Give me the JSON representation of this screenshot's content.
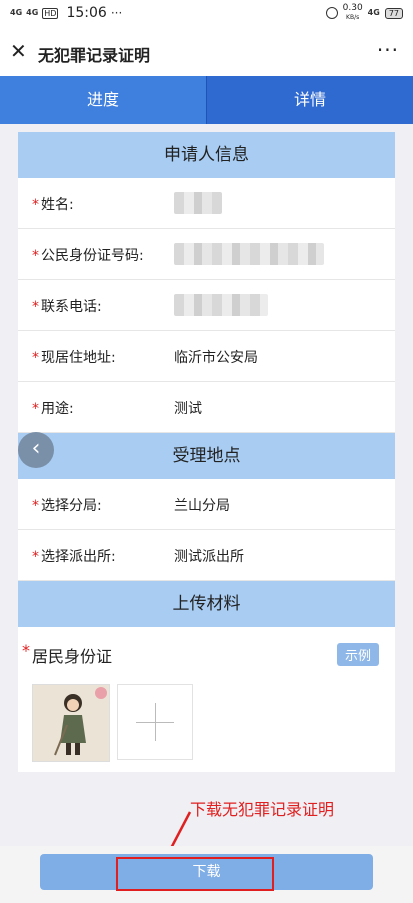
{
  "status_bar": {
    "signal1": "4G",
    "signal2": "4G",
    "hd": "HD",
    "time": "15:06",
    "dots": "···",
    "speed": "0.30",
    "speed_unit": "KB/s",
    "network": "4G",
    "battery": "77"
  },
  "nav": {
    "close_icon": "close-icon",
    "title": "无犯罪记录证明",
    "more": "···"
  },
  "tabs": [
    {
      "label": "进度"
    },
    {
      "label": "详情"
    }
  ],
  "sections": {
    "applicant": {
      "title": "申请人信息",
      "fields": [
        {
          "label": "姓名:",
          "value": ""
        },
        {
          "label": "公民身份证号码:",
          "value": ""
        },
        {
          "label": "联系电话:",
          "value": ""
        },
        {
          "label": "现居住地址:",
          "value": "临沂市公安局"
        },
        {
          "label": "用途:",
          "value": "测试"
        }
      ]
    },
    "location": {
      "title": "受理地点",
      "fields": [
        {
          "label": "选择分局:",
          "value": "兰山分局"
        },
        {
          "label": "选择派出所:",
          "value": "测试派出所"
        }
      ]
    },
    "upload": {
      "title": "上传材料",
      "doc_label": "居民身份证",
      "sample_label": "示例"
    }
  },
  "required_mark": "*",
  "back_icon": "chevron-left-icon",
  "annotation": "下载无犯罪记录证明",
  "download_label": "下载",
  "colors": {
    "tab_active": "#3f7fde",
    "section_head": "#a8ccf2",
    "download_button": "#7faee6",
    "annotation": "#e02020"
  }
}
